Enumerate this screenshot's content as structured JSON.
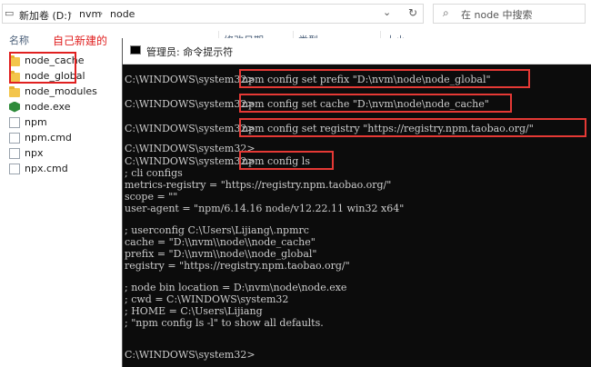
{
  "explorer": {
    "breadcrumb": [
      "新加卷 (D:)",
      "nvm",
      "node"
    ],
    "search_placeholder": "在 node 中搜索",
    "columns": [
      "名称",
      "修改日期",
      "类型",
      "大小"
    ],
    "annotation": "自己新建的",
    "files": [
      {
        "name": "node_cache",
        "icon": "folder-icon"
      },
      {
        "name": "node_global",
        "icon": "folder-icon"
      },
      {
        "name": "node_modules",
        "icon": "folder-icon"
      },
      {
        "name": "node.exe",
        "icon": "node-exe-icon"
      },
      {
        "name": "npm",
        "icon": "file-icon"
      },
      {
        "name": "npm.cmd",
        "icon": "file-icon"
      },
      {
        "name": "npx",
        "icon": "file-icon"
      },
      {
        "name": "npx.cmd",
        "icon": "file-icon"
      }
    ]
  },
  "console": {
    "title": "管理员: 命令提示符",
    "prompt": "C:\\WINDOWS\\system32>",
    "commands": [
      "npm config set prefix \"D:\\nvm\\node\\node_global\"",
      "npm config set cache \"D:\\nvm\\node\\node_cache\"",
      "npm config set registry \"https://registry.npm.taobao.org/\"",
      "npm config ls"
    ],
    "output": [
      "; cli configs",
      "metrics-registry = \"https://registry.npm.taobao.org/\"",
      "scope = \"\"",
      "user-agent = \"npm/6.14.16 node/v12.22.11 win32 x64\"",
      "",
      "; userconfig C:\\Users\\Lijiang\\.npmrc",
      "cache = \"D:\\\\nvm\\\\node\\\\node_cache\"",
      "prefix = \"D:\\\\nvm\\\\node\\\\node_global\"",
      "registry = \"https://registry.npm.taobao.org/\"",
      "",
      "; node bin location = D:\\nvm\\node\\node.exe",
      "; cwd = C:\\WINDOWS\\system32",
      "; HOME = C:\\Users\\Lijiang",
      "; \"npm config ls -l\" to show all defaults."
    ]
  },
  "colors": {
    "highlight": "#e53935",
    "console_bg": "#0c0c0c",
    "console_text": "#cccccc"
  }
}
